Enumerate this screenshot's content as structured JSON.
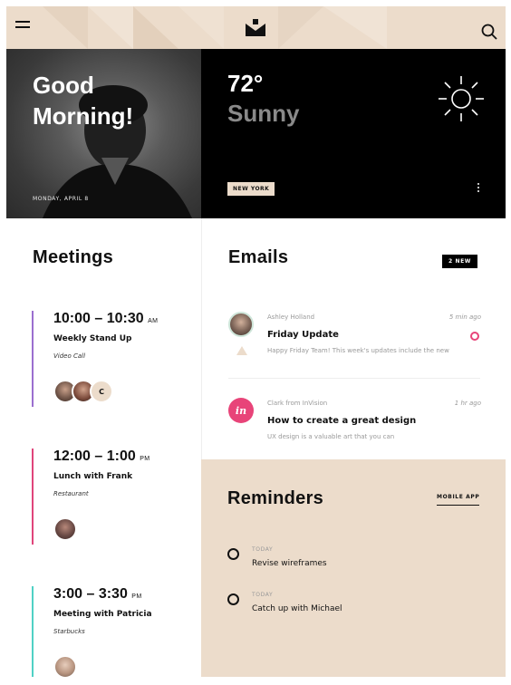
{
  "topbar": {
    "menu_icon": "hamburger-icon",
    "logo_icon": "brand-logo",
    "search_icon": "search-icon"
  },
  "hero": {
    "greeting_line1": "Good",
    "greeting_line2": "Morning!",
    "date": "MONDAY, APRIL 8"
  },
  "weather": {
    "temperature": "72°",
    "condition": "Sunny",
    "location": "NEW YORK",
    "icon": "sun-icon"
  },
  "meetings": {
    "title": "Meetings",
    "items": [
      {
        "time": "10:00 – 10:30",
        "ampm": "AM",
        "title": "Weekly Stand Up",
        "location": "Video Call",
        "color": "#9b6fcf",
        "extra_initial": "C"
      },
      {
        "time": "12:00 – 1:00",
        "ampm": "PM",
        "title": "Lunch with Frank",
        "location": "Restaurant",
        "color": "#e0457b"
      },
      {
        "time": "3:00 – 3:30",
        "ampm": "PM",
        "title": "Meeting with Patricia",
        "location": "Starbucks",
        "color": "#4fd1c5"
      }
    ]
  },
  "emails": {
    "title": "Emails",
    "new_badge": "2 NEW",
    "items": [
      {
        "sender": "Ashley Holland",
        "time": "5 min ago",
        "subject": "Friday Update",
        "preview": "Happy Friday Team! This week's updates include the new"
      },
      {
        "sender": "Clark from InVision",
        "time": "1 hr ago",
        "subject": "How to create a great design",
        "preview": "UX design is a valuable art that you can",
        "avatar_text": "in"
      }
    ]
  },
  "reminders": {
    "title": "Reminders",
    "link": "MOBILE APP",
    "items": [
      {
        "label": "TODAY",
        "text": "Revise wireframes"
      },
      {
        "label": "TODAY",
        "text": "Catch up with Michael"
      }
    ]
  },
  "colors": {
    "accent_beige": "#ecdccb",
    "invision_pink": "#e84479",
    "meeting_purple": "#9b6fcf",
    "meeting_pink": "#e0457b",
    "meeting_teal": "#4fd1c5"
  }
}
